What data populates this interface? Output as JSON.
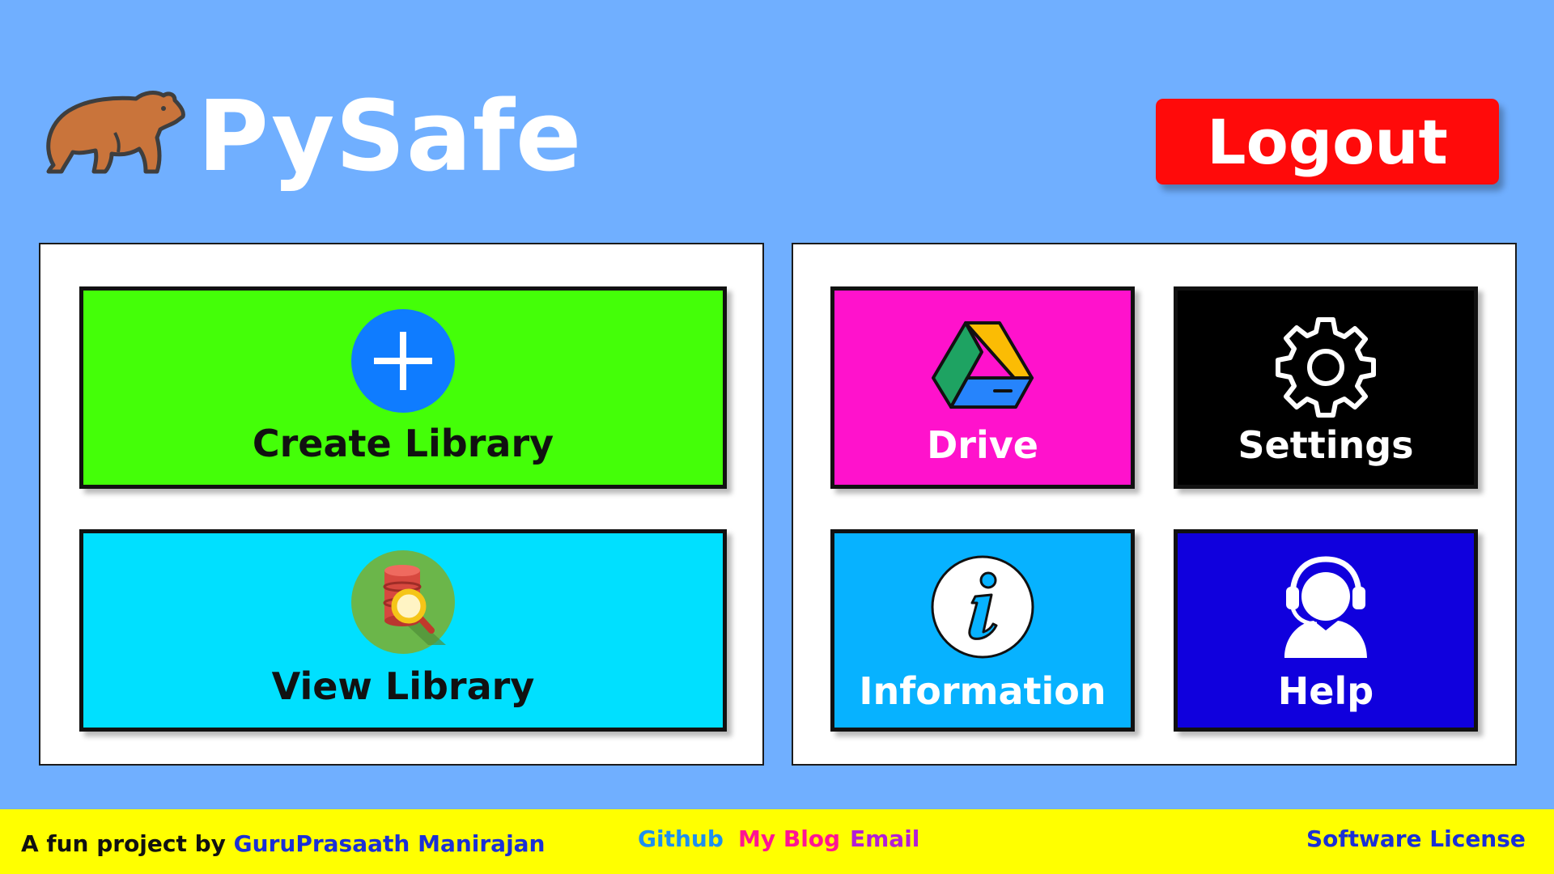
{
  "header": {
    "app_title": "PySafe",
    "logo_icon": "bear-icon",
    "logout_label": "Logout"
  },
  "left_panel": {
    "create_library": {
      "label": "Create Library",
      "icon": "plus-circle-icon"
    },
    "view_library": {
      "label": "View Library",
      "icon": "database-search-icon"
    }
  },
  "right_panel": {
    "drive": {
      "label": "Drive",
      "icon": "google-drive-icon"
    },
    "settings": {
      "label": "Settings",
      "icon": "gear-icon"
    },
    "information": {
      "label": "Information",
      "icon": "info-icon"
    },
    "help": {
      "label": "Help",
      "icon": "headset-support-icon"
    }
  },
  "footer": {
    "credit_prefix": "A fun project by ",
    "author": "GuruPrasaath Manirajan",
    "links": {
      "github": "Github",
      "blog": "My Blog",
      "email": "Email",
      "license": "Software License"
    }
  },
  "colors": {
    "background": "#70afff",
    "logout": "#ff0a0a",
    "create_library": "#44ff08",
    "view_library": "#00e0ff",
    "drive": "#ff12cc",
    "settings": "#000000",
    "information": "#07b2ff",
    "help": "#1000dd",
    "footer": "#ffff00"
  }
}
